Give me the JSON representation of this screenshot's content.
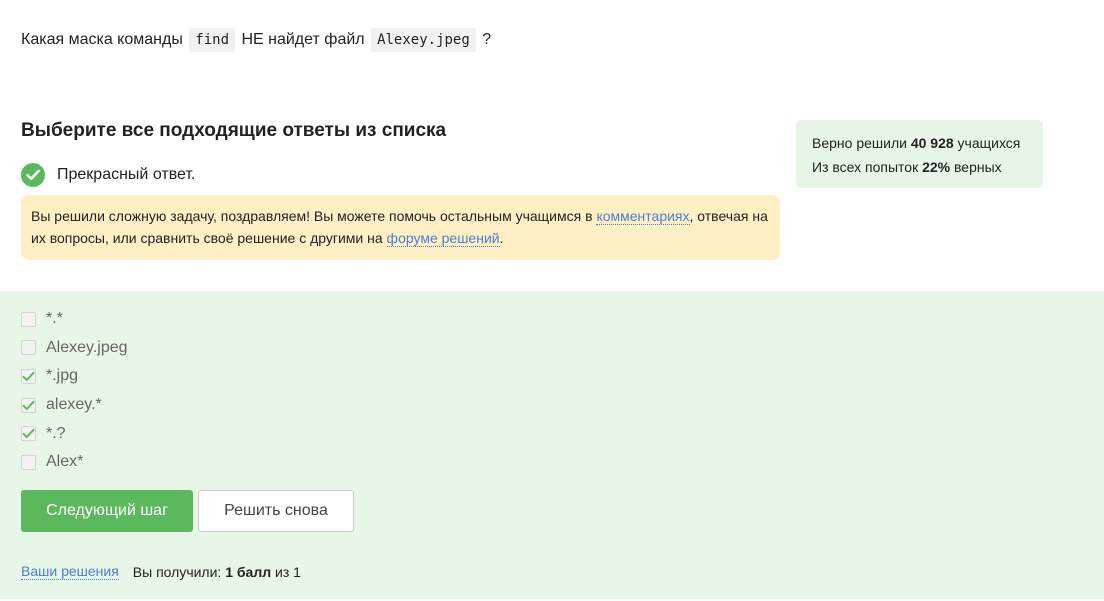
{
  "question": {
    "before": "Какая маска команды",
    "code1": "find",
    "middle": "НЕ найдет файл",
    "code2": "Alexey.jpeg",
    "after": "?"
  },
  "task": {
    "header": "Выберите все подходящие ответы из списка",
    "result": "Прекрасный ответ.",
    "status_icon": "check-circle-icon",
    "status_color": "#5cb85c"
  },
  "congrats": {
    "text1": "Вы решили сложную задачу, поздравляем! Вы можете помочь остальным учащимся в ",
    "link1": "комментариях",
    "text2": ", отвечая на их вопросы, или сравнить своё решение с другими на ",
    "link2": "форуме решений",
    "text3": ".",
    "bg_color": "#ffefc4"
  },
  "stats": {
    "line1_prefix": "Верно решили",
    "solved_count": "40 928",
    "line1_suffix": "учащихся",
    "line2_prefix": "Из всех попыток",
    "percent": "22%",
    "line2_suffix": "верных"
  },
  "options": [
    {
      "label": "*.*",
      "checked": false
    },
    {
      "label": "Alexey.jpeg",
      "checked": false
    },
    {
      "label": "*.jpg",
      "checked": true
    },
    {
      "label": "alexey.*",
      "checked": true
    },
    {
      "label": "*.?",
      "checked": true
    },
    {
      "label": "Alex*",
      "checked": false
    }
  ],
  "buttons": {
    "next": "Следующий шаг",
    "retry": "Решить снова"
  },
  "footer": {
    "solutions_link": "Ваши решения",
    "score_prefix": "Вы получили:",
    "score_value": "1 балл",
    "score_suffix": "из 1"
  },
  "colors": {
    "accent_green": "#5cb85c",
    "answer_bg": "#e8f6e8",
    "link": "#4a80d0"
  }
}
